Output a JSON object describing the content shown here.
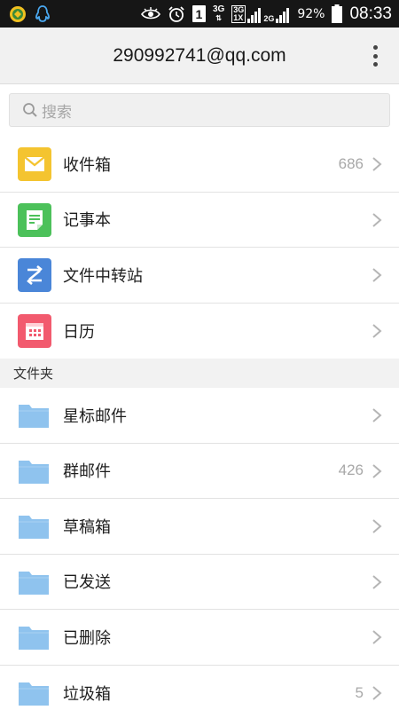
{
  "status_bar": {
    "network_3g": "3G",
    "sim_slot": "1",
    "net_3g_top": "3G",
    "net_1x": "1X",
    "net_2g": "2G",
    "battery": "92%",
    "time": "08:33"
  },
  "header": {
    "title": "290992741@qq.com",
    "more_icon": "more-vertical-icon"
  },
  "search": {
    "placeholder": "搜索"
  },
  "mailboxes": [
    {
      "label": "收件箱",
      "count": "686",
      "icon": "inbox-icon",
      "color": "#f4c430"
    },
    {
      "label": "记事本",
      "count": "",
      "icon": "notepad-icon",
      "color": "#4cc15a"
    },
    {
      "label": "文件中转站",
      "count": "",
      "icon": "file-transfer-icon",
      "color": "#4a86d8"
    },
    {
      "label": "日历",
      "count": "",
      "icon": "calendar-icon",
      "color": "#f25a6e"
    }
  ],
  "folders_section": {
    "label": "文件夹"
  },
  "folders": [
    {
      "label": "星标邮件",
      "count": ""
    },
    {
      "label": "群邮件",
      "count": "426"
    },
    {
      "label": "草稿箱",
      "count": ""
    },
    {
      "label": "已发送",
      "count": ""
    },
    {
      "label": "已删除",
      "count": ""
    },
    {
      "label": "垃圾箱",
      "count": "5"
    }
  ],
  "colors": {
    "folder": "#8fc3ee",
    "status_bar": "#161616",
    "header_bg": "#f1f1f1"
  }
}
